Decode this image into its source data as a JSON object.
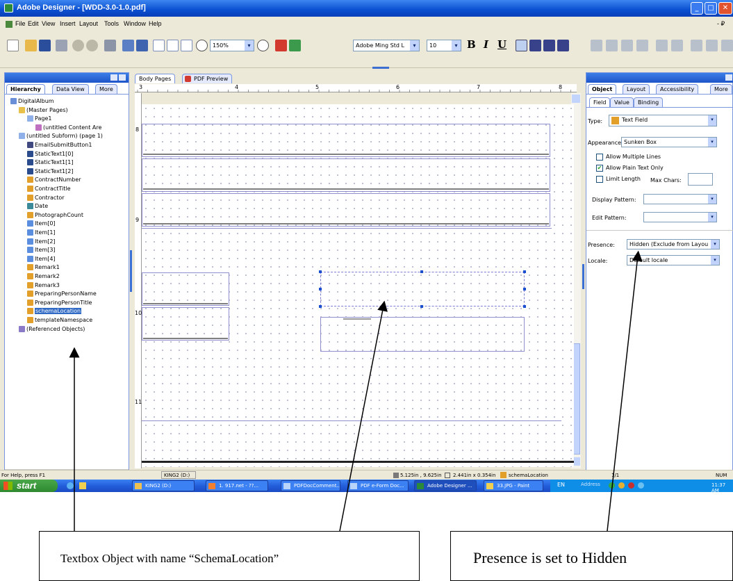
{
  "window": {
    "title": "Adobe Designer - [WDD-3.0-1.0.pdf]",
    "controls": [
      "_",
      "□",
      "✕"
    ],
    "doc_controls": "- ₽"
  },
  "menu": [
    "File",
    "Edit",
    "View",
    "Insert",
    "Layout",
    "Tools",
    "Window",
    "Help"
  ],
  "toolbar": {
    "zoom": "150%",
    "font": "Adobe Ming Std L",
    "size": "10",
    "bold": "B",
    "italic": "I",
    "underline": "U"
  },
  "left_panel": {
    "tabs": [
      "Hierarchy",
      "Data View",
      "More"
    ],
    "tree": [
      {
        "label": "DigitalAlbum",
        "depth": 0,
        "icon": "doc"
      },
      {
        "label": "(Master Pages)",
        "depth": 1,
        "icon": "folder"
      },
      {
        "label": "Page1",
        "depth": 2,
        "icon": "page"
      },
      {
        "label": "(untitled Content Are",
        "depth": 3,
        "icon": "content"
      },
      {
        "label": "(untitled Subform) (page 1)",
        "depth": 1,
        "icon": "page"
      },
      {
        "label": "EmailSubmitButton1",
        "depth": 2,
        "icon": "button"
      },
      {
        "label": "StaticText1[0]",
        "depth": 2,
        "icon": "text"
      },
      {
        "label": "StaticText1[1]",
        "depth": 2,
        "icon": "text"
      },
      {
        "label": "StaticText1[2]",
        "depth": 2,
        "icon": "text"
      },
      {
        "label": "ContractNumber",
        "depth": 2,
        "icon": "field"
      },
      {
        "label": "ContractTitle",
        "depth": 2,
        "icon": "field"
      },
      {
        "label": "Contractor",
        "depth": 2,
        "icon": "field"
      },
      {
        "label": "Date",
        "depth": 2,
        "icon": "date"
      },
      {
        "label": "PhotographCount",
        "depth": 2,
        "icon": "field"
      },
      {
        "label": "Item[0]",
        "depth": 2,
        "icon": "subform"
      },
      {
        "label": "Item[1]",
        "depth": 2,
        "icon": "subform"
      },
      {
        "label": "Item[2]",
        "depth": 2,
        "icon": "subform"
      },
      {
        "label": "Item[3]",
        "depth": 2,
        "icon": "subform"
      },
      {
        "label": "Item[4]",
        "depth": 2,
        "icon": "subform"
      },
      {
        "label": "Remark1",
        "depth": 2,
        "icon": "field"
      },
      {
        "label": "Remark2",
        "depth": 2,
        "icon": "field"
      },
      {
        "label": "Remark3",
        "depth": 2,
        "icon": "field"
      },
      {
        "label": "PreparingPersonName",
        "depth": 2,
        "icon": "field"
      },
      {
        "label": "PreparingPersonTitle",
        "depth": 2,
        "icon": "field"
      },
      {
        "label": "schemaLocation",
        "depth": 2,
        "icon": "field",
        "selected": true
      },
      {
        "label": "templateNamespace",
        "depth": 2,
        "icon": "field"
      },
      {
        "label": "(Referenced Objects)",
        "depth": 1,
        "icon": "refs"
      }
    ]
  },
  "center": {
    "tabs": [
      "Body Pages",
      "PDF Preview"
    ],
    "ruler_numbers": [
      "3",
      "4",
      "5",
      "6",
      "7",
      "8"
    ],
    "side_ruler_numbers": [
      "8",
      "9",
      "10",
      "11"
    ]
  },
  "right_panel": {
    "tabs": [
      "Object",
      "Layout",
      "Accessibility",
      "More"
    ],
    "subtabs": [
      "Field",
      "Value",
      "Binding"
    ],
    "type_label": "Type:",
    "type_value": "Text Field",
    "appearance_label": "Appearance:",
    "appearance_value": "Sunken Box",
    "allow_multiple_lines": "Allow Multiple Lines",
    "allow_plain_text": "Allow Plain Text Only",
    "limit_length": "Limit Length",
    "max_chars": "Max Chars:",
    "display_pattern": "Display Pattern:",
    "edit_pattern": "Edit Pattern:",
    "presence_label": "Presence:",
    "presence_value": "Hidden (Exclude from Layou",
    "locale_label": "Locale:",
    "locale_value": "Default locale"
  },
  "statusbar": {
    "help": "For Help, press F1",
    "drive": "KING2 (D:)",
    "coords": "5.125in , 9.625in",
    "size": "2.441in x 0.354in",
    "object": "schemaLocation",
    "page": "1/1",
    "num": "NUM"
  },
  "taskbar": {
    "start": "start",
    "tasks": [
      "KING2 (D:)",
      "1. 917.net - ??...",
      "PDFDocComment...",
      "PDF e-Form Doc...",
      "Adobe Designer ...",
      "33.JPG - Paint"
    ],
    "lang": "EN",
    "address": "Address",
    "clock": "11:37 AM"
  },
  "callouts": {
    "left": "Textbox Object with name “SchemaLocation”",
    "right": "Presence is set to Hidden"
  }
}
